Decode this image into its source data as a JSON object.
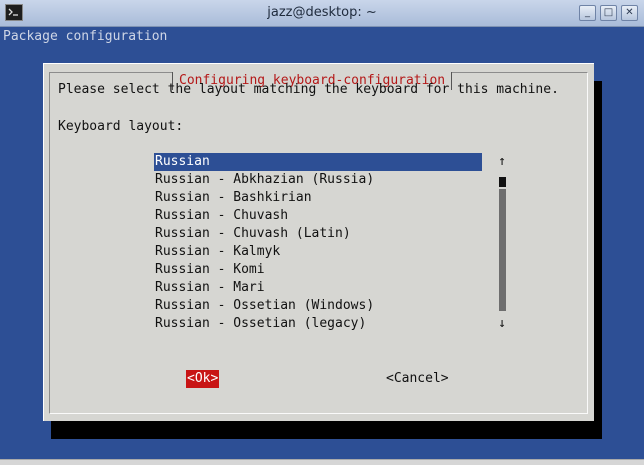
{
  "window": {
    "title": "jazz@desktop: ~",
    "controls": {
      "minimize": "_",
      "maximize": "□",
      "close": "✕"
    }
  },
  "terminal": {
    "header": "Package configuration"
  },
  "dialog": {
    "title": "Configuring keyboard-configuration",
    "prompt": "Please select the layout matching the keyboard for this machine.",
    "field_label": "Keyboard layout:",
    "items": [
      "Russian",
      "Russian - Abkhazian (Russia)",
      "Russian - Bashkirian",
      "Russian - Chuvash",
      "Russian - Chuvash (Latin)",
      "Russian - Kalmyk",
      "Russian - Komi",
      "Russian - Mari",
      "Russian - Ossetian (Windows)",
      "Russian - Ossetian (legacy)"
    ],
    "selected_index": 0,
    "scroll_up": "↑",
    "scroll_down": "↓",
    "ok_label": "<Ok>",
    "cancel_label": "<Cancel>"
  },
  "colors": {
    "terminal_bg": "#2d4f95",
    "dialog_bg": "#d6d6d2",
    "title_red": "#b41818",
    "ok_bg": "#c81414"
  }
}
